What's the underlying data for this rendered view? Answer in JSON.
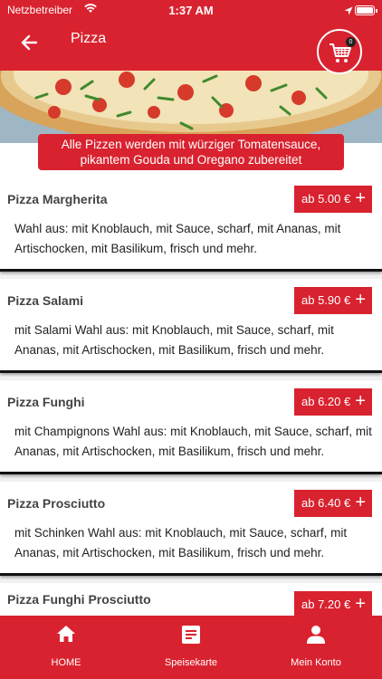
{
  "status_bar": {
    "carrier": "Netzbetreiber",
    "time": "1:37 AM"
  },
  "header": {
    "title": "Pizza",
    "cart_count": "0"
  },
  "banner": {
    "line1": "Alle Pizzen werden mit würziger Tomatensauce,",
    "line2": "pikantem Gouda und Oregano zubereitet"
  },
  "items": [
    {
      "name": "Pizza Margherita",
      "price": "ab 5.00 €",
      "desc": "Wahl aus: mit Knoblauch, mit Sauce, scharf, mit Ananas, mit Artischocken, mit Basilikum, frisch und mehr."
    },
    {
      "name": "Pizza Salami",
      "price": "ab 5.90 €",
      "desc": "mit Salami Wahl aus: mit Knoblauch, mit Sauce, scharf, mit Ananas, mit Artischocken, mit Basilikum, frisch und mehr."
    },
    {
      "name": "Pizza Funghi",
      "price": "ab 6.20 €",
      "desc": "mit Champignons Wahl aus: mit Knoblauch, mit Sauce, scharf, mit Ananas, mit Artischocken, mit Basilikum, frisch und mehr."
    },
    {
      "name": "Pizza Prosciutto",
      "price": "ab 6.40 €",
      "desc": "mit Schinken Wahl aus: mit Knoblauch, mit Sauce, scharf, mit Ananas, mit Artischocken, mit Basilikum, frisch und mehr."
    },
    {
      "name": "Pizza Funghi Prosciutto",
      "price": "ab 7.20 €",
      "desc": ""
    }
  ],
  "tabs": [
    {
      "label": "HOME",
      "icon": "home-icon"
    },
    {
      "label": "Speisekarte",
      "icon": "menu-card-icon"
    },
    {
      "label": "Mein Konto",
      "icon": "user-icon"
    }
  ],
  "colors": {
    "brand_red": "#d9222f",
    "text_dark": "#222222",
    "item_name": "#444444"
  }
}
